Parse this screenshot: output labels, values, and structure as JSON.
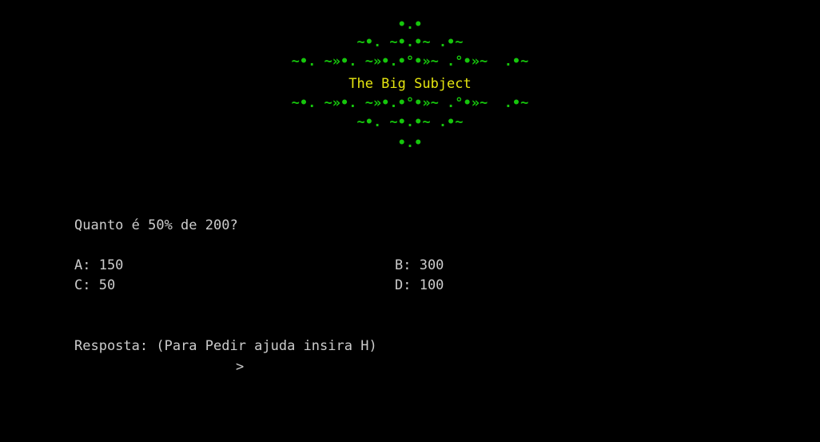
{
  "banner": {
    "lines": [
      "•.•",
      "~•. ~•.•~ .•~",
      "~•. ~»•. ~»•.•°•»~ .°•»~  .•~",
      "The Big Subject",
      "~•. ~»•. ~»•.•°•»~ .°•»~  .•~",
      "~•. ~•.•~ .•~",
      "•.•"
    ],
    "title": "The Big Subject",
    "title_color": "#e5e510",
    "ornament_color": "#16c60c"
  },
  "question": {
    "text": "Quanto é 50% de 200?"
  },
  "options": {
    "a": "A: 150",
    "b": "B: 300",
    "c": "C: 50",
    "d": "D: 100"
  },
  "answer": {
    "prompt": "Resposta: (Para Pedir ajuda insira H)",
    "cursor": ">"
  },
  "colors": {
    "background": "#000000",
    "text": "#cccccc"
  }
}
